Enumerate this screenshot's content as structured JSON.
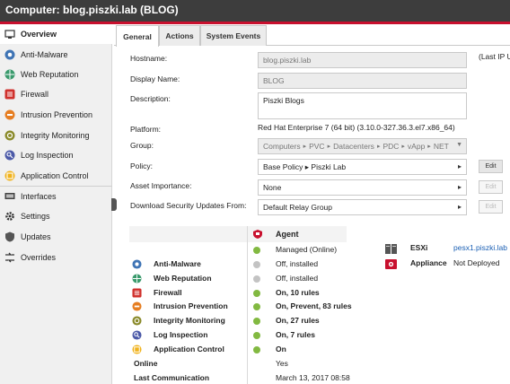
{
  "window": {
    "title_prefix": "Computer:",
    "title_host": "blog.piszki.lab (BLOG)"
  },
  "sidebar": {
    "items": [
      {
        "label": "Overview",
        "icon": "overview-icon"
      },
      {
        "label": "Anti-Malware",
        "icon": "anti-malware-icon"
      },
      {
        "label": "Web Reputation",
        "icon": "web-reputation-icon"
      },
      {
        "label": "Firewall",
        "icon": "firewall-icon"
      },
      {
        "label": "Intrusion Prevention",
        "icon": "intrusion-prevention-icon"
      },
      {
        "label": "Integrity Monitoring",
        "icon": "integrity-monitoring-icon"
      },
      {
        "label": "Log Inspection",
        "icon": "log-inspection-icon"
      },
      {
        "label": "Application Control",
        "icon": "application-control-icon"
      },
      {
        "label": "Interfaces",
        "icon": "interfaces-icon"
      },
      {
        "label": "Settings",
        "icon": "gear-icon"
      },
      {
        "label": "Updates",
        "icon": "updates-icon"
      },
      {
        "label": "Overrides",
        "icon": "overrides-icon"
      }
    ]
  },
  "tabs": [
    {
      "label": "General"
    },
    {
      "label": "Actions"
    },
    {
      "label": "System Events"
    }
  ],
  "general": {
    "hostname_label": "Hostname:",
    "hostname_value": "blog.piszki.lab",
    "last_ip_label": "(Last IP U",
    "display_name_label": "Display Name:",
    "display_name_value": "BLOG",
    "description_label": "Description:",
    "description_value": "Piszki Blogs",
    "platform_label": "Platform:",
    "platform_value": "Red Hat Enterprise 7 (64 bit) (3.10.0-327.36.3.el7.x86_64)",
    "group_label": "Group:",
    "group_path": [
      "Computers",
      "PVC",
      "Datacenters",
      "PDC",
      "vApp",
      "NET"
    ],
    "policy_label": "Policy:",
    "policy_value": "Base Policy ▸ Piszki Lab",
    "asset_label": "Asset Importance:",
    "asset_value": "None",
    "download_label": "Download Security Updates From:",
    "download_value": "Default Relay Group",
    "edit_label": "Edit"
  },
  "agent": {
    "header": "Agent",
    "status": "Managed (Online)",
    "modules": [
      {
        "name": "Anti-Malware",
        "status": "Off, installed",
        "state": "off"
      },
      {
        "name": "Web Reputation",
        "status": "Off, installed",
        "state": "off"
      },
      {
        "name": "Firewall",
        "status": "On, 10 rules",
        "state": "on"
      },
      {
        "name": "Intrusion Prevention",
        "status": "On, Prevent, 83 rules",
        "state": "on"
      },
      {
        "name": "Integrity Monitoring",
        "status": "On, 27 rules",
        "state": "on"
      },
      {
        "name": "Log Inspection",
        "status": "On, 7 rules",
        "state": "on"
      },
      {
        "name": "Application Control",
        "status": "On",
        "state": "on"
      }
    ],
    "online_label": "Online",
    "online_value": "Yes",
    "last_comm_label": "Last Communication",
    "last_comm_value": "March 13, 2017 08:58"
  },
  "esxi": {
    "label": "ESXi",
    "value": "pesx1.piszki.lab",
    "appliance_label": "Appliance",
    "appliance_value": "Not Deployed"
  },
  "colors": {
    "accent": "#c8102e",
    "on": "#82b941",
    "off": "#c3c3c3",
    "link": "#1a5fb4"
  }
}
